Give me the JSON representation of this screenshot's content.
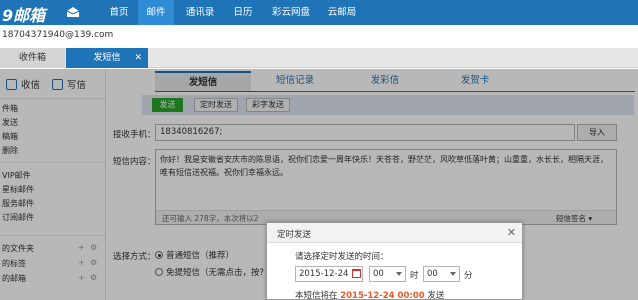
{
  "logo": "9邮箱",
  "nav": [
    "首页",
    "邮件",
    "通讯录",
    "日历",
    "彩云网盘",
    "云邮局"
  ],
  "account": "18704371940@139.com",
  "tabs": {
    "inbox": "收件箱",
    "send_sms": "发短信",
    "close": "✕"
  },
  "sidebar": {
    "receive": "收信",
    "write": "写信",
    "items": [
      "件箱",
      "发送",
      "稿箱",
      "删除",
      "VIP邮件",
      "星标邮件",
      "服务邮件",
      "订阅邮件",
      "的文件夹",
      "的标签",
      "的邮箱"
    ],
    "plus": "+",
    "gear": "⚙"
  },
  "main_tabs": [
    "发短信",
    "短信记录",
    "发彩信",
    "发贺卡"
  ],
  "toolbar": {
    "send": "发送",
    "timed_send": "定时发送",
    "color_sms": "彩字发送"
  },
  "form": {
    "recipient_label": "接收手机：",
    "recipient_value": "18340816267;",
    "import_button": "导入",
    "content_label": "短信内容：",
    "content": "你好！我是安徽省安庆市的陈思语，祝你们恋爱一周年快乐！天苍苍，野茫茫，风吹草低落叶黄；山重重，水长长，相隔天涯，唯有短信送祝福。祝你们幸福永远。",
    "counter": "还可输入 278字，本次将以2",
    "signature": "短信签名 ▾",
    "method_label": "选择方式：",
    "option1": "普通短信（推荐）",
    "option2": "免提短信（无需点击，按?"
  },
  "dialog": {
    "title": "定时发送",
    "close": "✕",
    "prompt": "请选择定时发送的时间：",
    "date": "2015-12-24",
    "hour": "00",
    "hour_unit": "时",
    "minute": "00",
    "minute_unit": "分",
    "note_prefix": "本短信将在",
    "note_time": "2015-12-24 00:00",
    "note_suffix": "发送"
  }
}
